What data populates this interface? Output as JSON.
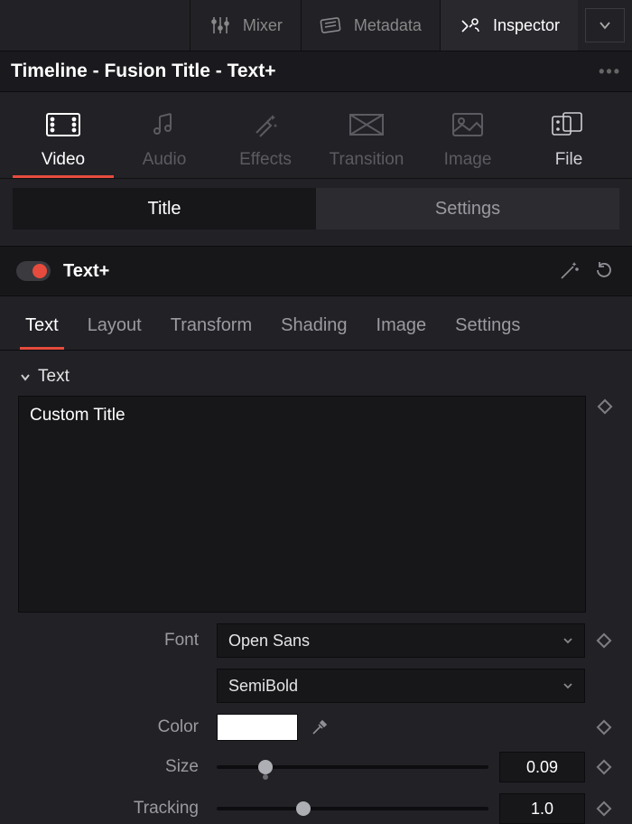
{
  "workspace_tabs": {
    "mixer": "Mixer",
    "metadata": "Metadata",
    "inspector": "Inspector"
  },
  "clip_title": "Timeline - Fusion Title - Text+",
  "categories": {
    "video": "Video",
    "audio": "Audio",
    "effects": "Effects",
    "transition": "Transition",
    "image": "Image",
    "file": "File"
  },
  "seg": {
    "title": "Title",
    "settings": "Settings"
  },
  "plugin": {
    "name": "Text+"
  },
  "subtabs": {
    "text": "Text",
    "layout": "Layout",
    "transform": "Transform",
    "shading": "Shading",
    "image": "Image",
    "settings": "Settings"
  },
  "section": {
    "text": "Text"
  },
  "params": {
    "text_value": "Custom Title",
    "font_label": "Font",
    "font_family": "Open Sans",
    "font_style": "SemiBold",
    "color_label": "Color",
    "color_value": "#FFFFFF",
    "size_label": "Size",
    "size_value": "0.09",
    "size_slider_pct": 18,
    "size_default_pct": 18,
    "tracking_label": "Tracking",
    "tracking_value": "1.0",
    "tracking_slider_pct": 32
  }
}
